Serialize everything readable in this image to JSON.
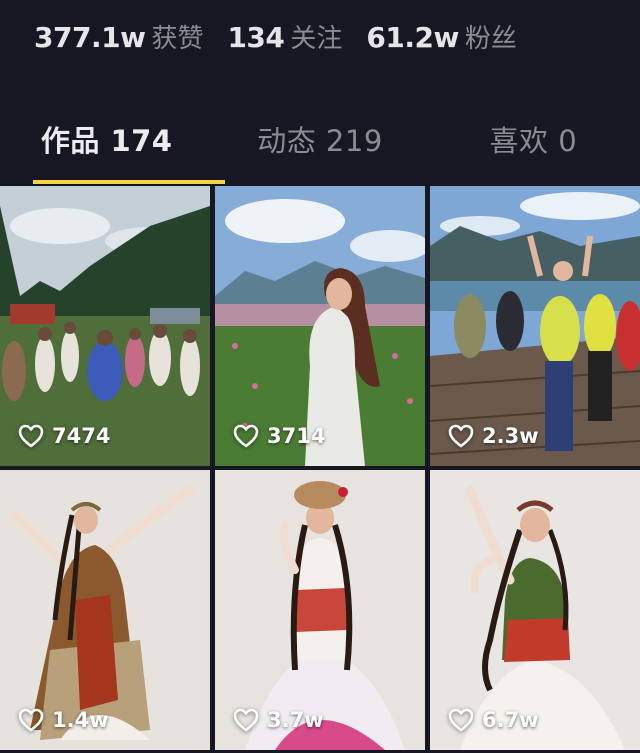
{
  "stats": [
    {
      "value": "377.1w",
      "label": "获赞"
    },
    {
      "value": "134",
      "label": "关注"
    },
    {
      "value": "61.2w",
      "label": "粉丝"
    }
  ],
  "tabs": [
    {
      "label": "作品 174",
      "active": true
    },
    {
      "label": "动态 219",
      "active": false
    },
    {
      "label": "喜欢 0",
      "active": false
    }
  ],
  "accent_color": "#f5d544",
  "videos": [
    {
      "likes": "7474",
      "scene": "group dancing on mountain meadow"
    },
    {
      "likes": "3714",
      "scene": "woman in flower field by lake"
    },
    {
      "likes": "2.3w",
      "scene": "group cheering on lakeside boardwalk"
    },
    {
      "likes": "1.4w",
      "scene": "dancer in patterned costume"
    },
    {
      "likes": "3.7w",
      "scene": "dancer with fur hat and braids"
    },
    {
      "likes": "6.7w",
      "scene": "dancer in embroidered dress"
    }
  ]
}
